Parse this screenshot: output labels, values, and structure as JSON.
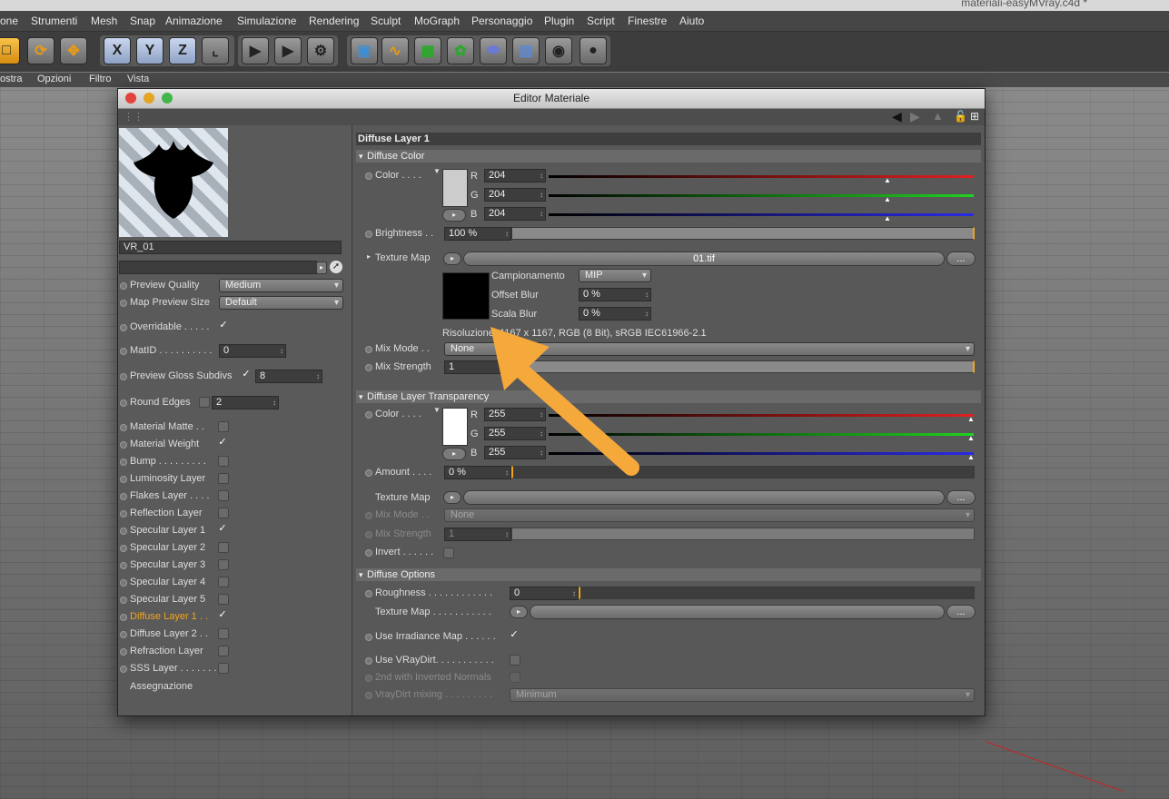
{
  "app": {
    "file_title": "materiali-easyMVray.c4d *",
    "menu": [
      "one",
      "Strumenti",
      "Mesh",
      "Snap",
      "Animazione",
      "Simulazione",
      "Rendering",
      "Sculpt",
      "MoGraph",
      "Personaggio",
      "Plugin",
      "Script",
      "Finestre",
      "Aiuto"
    ],
    "toolbar_axis": [
      "X",
      "Y",
      "Z"
    ],
    "subbar": [
      "ostra",
      "Opzioni",
      "Filtro",
      "Vista"
    ]
  },
  "editor": {
    "title": "Editor Materiale",
    "material_name": "VR_01",
    "preview_quality_label": "Preview Quality",
    "preview_quality": "Medium",
    "map_preview_size_label": "Map Preview Size",
    "map_preview_size": "Default",
    "overridable_label": "Overridable . . . . .",
    "matid_label": "MatID . . . . . . . . . .",
    "matid": "0",
    "gloss_label": "Preview Gloss Subdivs",
    "gloss": "8",
    "round_edges_label": "Round Edges",
    "round_edges": "2",
    "layers": [
      {
        "label": "Material Matte . .",
        "checked": false
      },
      {
        "label": "Material Weight",
        "checked": true
      },
      {
        "label": "Bump . . . . . . . . .",
        "checked": false
      },
      {
        "label": "Luminosity Layer",
        "checked": false
      },
      {
        "label": "Flakes Layer . . . .",
        "checked": false
      },
      {
        "label": "Reflection Layer",
        "checked": false
      },
      {
        "label": "Specular Layer 1",
        "checked": true
      },
      {
        "label": "Specular Layer 2",
        "checked": false
      },
      {
        "label": "Specular Layer 3",
        "checked": false
      },
      {
        "label": "Specular Layer 4",
        "checked": false
      },
      {
        "label": "Specular Layer 5",
        "checked": false
      },
      {
        "label": "Diffuse Layer 1 . .",
        "checked": true,
        "active": true
      },
      {
        "label": "Diffuse Layer 2 . .",
        "checked": false
      },
      {
        "label": "Refraction Layer",
        "checked": false
      },
      {
        "label": "SSS Layer . . . . . . .",
        "checked": false
      }
    ],
    "assignment": "Assegnazione"
  },
  "diffuse": {
    "header": "Diffuse Layer 1",
    "color_section": "Diffuse Color",
    "color_label": "Color . . . .",
    "r": "204",
    "g": "204",
    "b": "204",
    "brightness_label": "Brightness . .",
    "brightness": "100 %",
    "texture_map_label": "Texture Map",
    "texture_file": "01.tif",
    "sampling_label": "Campionamento",
    "sampling": "MIP",
    "offset_blur_label": "Offset Blur",
    "offset_blur": "0 %",
    "scale_blur_label": "Scala Blur",
    "scale_blur": "0 %",
    "resolution": "Risoluzione: 1167 x 1167, RGB (8 Bit), sRGB IEC61966-2.1",
    "mix_mode_label": "Mix Mode . .",
    "mix_mode": "None",
    "mix_strength_label": "Mix Strength",
    "mix_strength": "1",
    "transparency_section": "Diffuse Layer Transparency",
    "t_color_label": "Color . . . .",
    "tr": "255",
    "tg": "255",
    "tb": "255",
    "amount_label": "Amount . . . .",
    "amount": "0 %",
    "t_texture_label": "Texture Map",
    "t_mix_mode_label": "Mix Mode . .",
    "t_mix_mode": "None",
    "t_mix_strength_label": "Mix Strength",
    "t_mix_strength": "1",
    "invert_label": "Invert . . . . . .",
    "options_section": "Diffuse Options",
    "roughness_label": "Roughness . . . . . . . . . . . .",
    "roughness": "0",
    "o_texture_label": "Texture Map . . . . . . . . . . .",
    "irradiance_label": "Use Irradiance Map . . . . . .",
    "vraydirt_label": "Use VRayDirt. . . . . . . . . . .",
    "inverted_normals_label": "2nd with Inverted Normals",
    "vraydirt_mixing_label": "VrayDirt mixing . . . . . . . . .",
    "vraydirt_mixing": "Minimum"
  },
  "colors": {
    "accent": "#f1a51d",
    "red": "#e0201f",
    "green": "#1fd21f",
    "blue": "#2a2ae6"
  }
}
